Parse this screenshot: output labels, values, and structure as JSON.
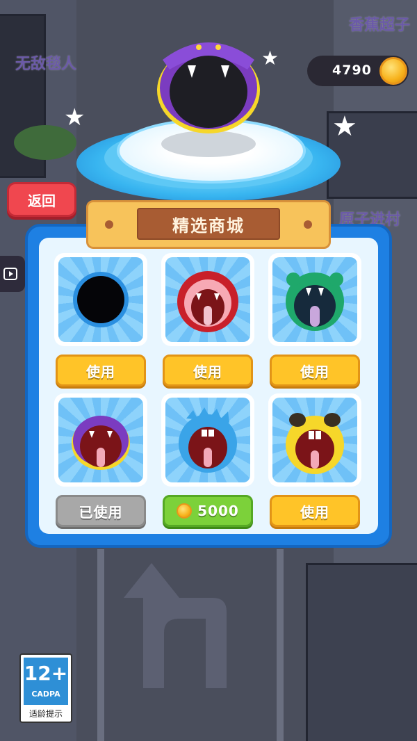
{
  "background_labels": {
    "top_right": "香蕉超子",
    "top_left": "无敌毯人",
    "right": "原子进村"
  },
  "coins": {
    "count": "4790"
  },
  "back_button": {
    "label": "返回"
  },
  "shop": {
    "title": "精选商城",
    "items": [
      {
        "skin": "black-hole",
        "button": "使用",
        "state": "use"
      },
      {
        "skin": "red-lion-mouth",
        "button": "使用",
        "state": "use"
      },
      {
        "skin": "green-monster-mouth",
        "button": "使用",
        "state": "use"
      },
      {
        "skin": "purple-snake-mouth",
        "button": "已使用",
        "state": "used"
      },
      {
        "skin": "blue-monster-mouth",
        "button": "5000",
        "state": "buy"
      },
      {
        "skin": "yellow-pug-mouth",
        "button": "使用",
        "state": "use"
      }
    ]
  },
  "age_rating": {
    "age": "12+",
    "org": "CADPA",
    "hint": "适龄提示"
  },
  "colors": {
    "panel": "#1e80e3",
    "use_button": "#ffc428",
    "buy_button": "#7cd13a",
    "used_button": "#a8a8a8"
  }
}
